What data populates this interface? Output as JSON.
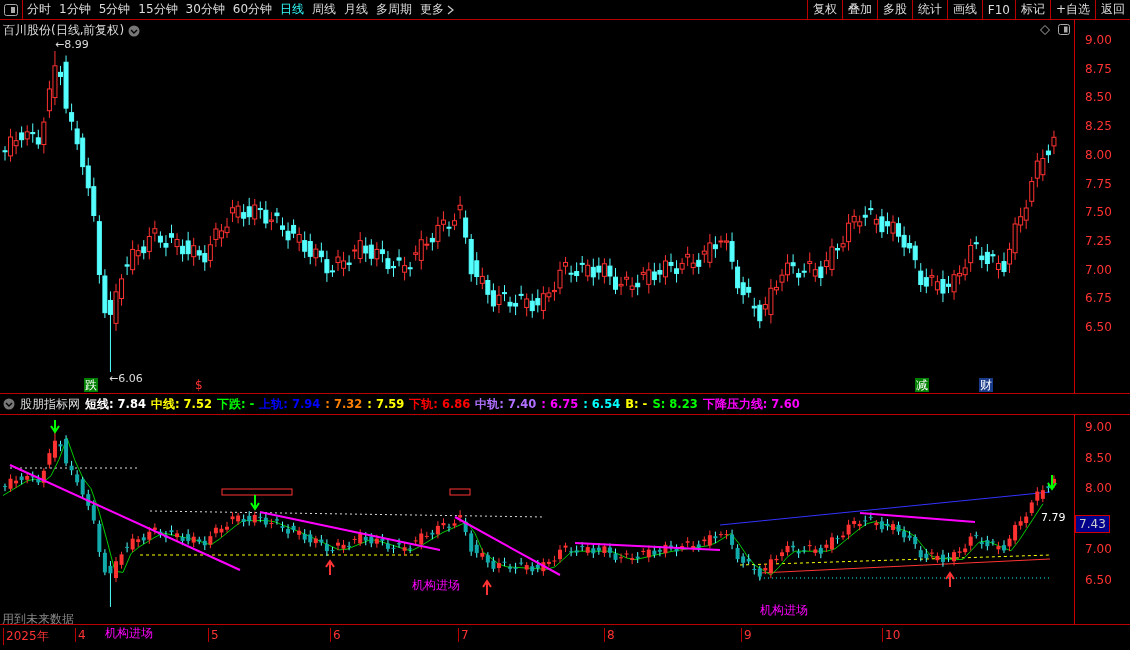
{
  "toolbar": {
    "periods": [
      {
        "label": "分时",
        "selected": false
      },
      {
        "label": "1分钟",
        "selected": false
      },
      {
        "label": "5分钟",
        "selected": false
      },
      {
        "label": "15分钟",
        "selected": false
      },
      {
        "label": "30分钟",
        "selected": false
      },
      {
        "label": "60分钟",
        "selected": false
      },
      {
        "label": "日线",
        "selected": true
      },
      {
        "label": "周线",
        "selected": false
      },
      {
        "label": "月线",
        "selected": false
      },
      {
        "label": "多周期",
        "selected": false
      }
    ],
    "more": "更多",
    "buttons": [
      "复权",
      "叠加",
      "多股",
      "统计",
      "画线",
      "F10",
      "标记",
      "+自选",
      "返回"
    ]
  },
  "main_panel": {
    "title": "百川股份(日线,前复权)",
    "high_label": "←8.99",
    "low_label": "←6.06",
    "markers": [
      {
        "label": "跌",
        "color": "#008000"
      },
      {
        "label": "$",
        "color": "#000000"
      },
      {
        "label": "减",
        "color": "#008000"
      },
      {
        "label": "财",
        "color": "#1a3a8a"
      }
    ],
    "price_axis": [
      "9.00",
      "8.75",
      "8.50",
      "8.25",
      "8.00",
      "7.75",
      "7.50",
      "7.25",
      "7.00",
      "6.75",
      "6.50"
    ]
  },
  "indicator_panel": {
    "name": "股朋指标网",
    "legend": [
      {
        "text": "短线: 7.84",
        "color": "#ffffff"
      },
      {
        "text": "中线: 7.52",
        "color": "#ffff00"
      },
      {
        "text": "下跌: -",
        "color": "#00ff00"
      },
      {
        "text": "上轨: 7.94",
        "color": "#0000ff"
      },
      {
        "text": ": 7.32",
        "color": "#ff8000"
      },
      {
        "text": ": 7.59",
        "color": "#ffff00"
      },
      {
        "text": "下轨: 6.86",
        "color": "#ff0000"
      },
      {
        "text": "中轨: 7.40",
        "color": "#b070ff"
      },
      {
        "text": ": 6.75",
        "color": "#ff00ff"
      },
      {
        "text": ": 6.54",
        "color": "#00ffff"
      },
      {
        "text": "B: -",
        "color": "#ffff00"
      },
      {
        "text": "S: 8.23",
        "color": "#00ff00"
      },
      {
        "text": "下降压力线: 7.60",
        "color": "#ff00ff"
      }
    ],
    "entry_labels": [
      "机构进场",
      "机构进场",
      "机构进场"
    ],
    "value_label": "7.79",
    "note": "用到未来数据",
    "price_axis": [
      {
        "label": "9.00",
        "current": false
      },
      {
        "label": "8.50",
        "current": false
      },
      {
        "label": "8.00",
        "current": false
      },
      {
        "label": "7.43",
        "current": true
      },
      {
        "label": "7.00",
        "current": false
      },
      {
        "label": "6.50",
        "current": false
      }
    ]
  },
  "date_axis": [
    "2025年",
    "4",
    "5",
    "6",
    "7",
    "8",
    "9",
    "10"
  ]
}
